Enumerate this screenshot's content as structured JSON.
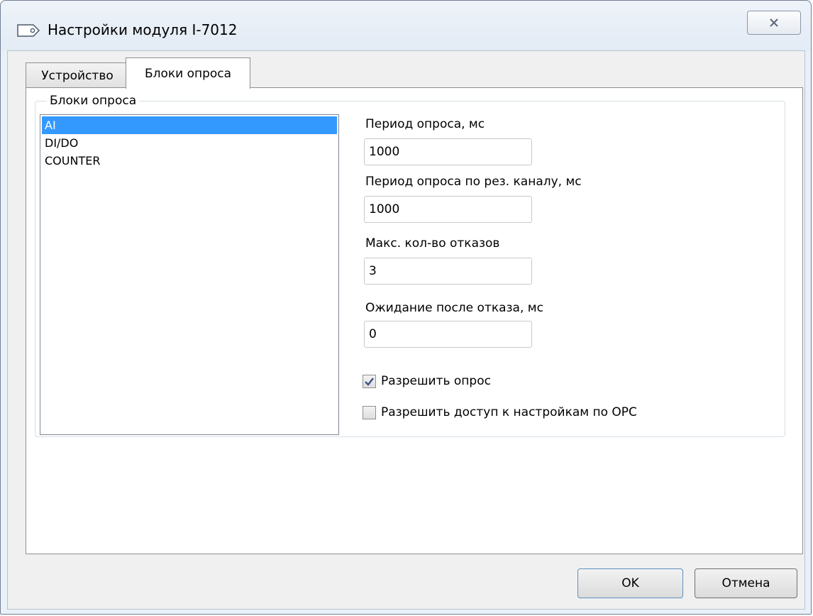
{
  "window": {
    "title": "Настройки модуля I-7012",
    "close_icon": "close-icon"
  },
  "tabs": [
    {
      "label": "Устройство",
      "active": false
    },
    {
      "label": "Блоки опроса",
      "active": true
    }
  ],
  "group": {
    "title": "Блоки опроса",
    "list_items": [
      {
        "label": "AI",
        "selected": true
      },
      {
        "label": "DI/DO",
        "selected": false
      },
      {
        "label": "COUNTER",
        "selected": false
      }
    ]
  },
  "fields": {
    "poll_period": {
      "label": "Период опроса, мс",
      "value": "1000"
    },
    "reserve_poll_period": {
      "label": "Период опроса по рез. каналу, мс",
      "value": "1000"
    },
    "max_failures": {
      "label": "Макс. кол-во отказов",
      "value": "3"
    },
    "wait_after_failure": {
      "label": "Ожидание после отказа, мс",
      "value": "0"
    }
  },
  "checkboxes": {
    "enable_poll": {
      "label": "Разрешить опрос",
      "checked": true
    },
    "opc_access": {
      "label": "Разрешить доступ к настройкам по OPC",
      "checked": false
    }
  },
  "buttons": {
    "ok": "OK",
    "cancel": "Отмена"
  }
}
